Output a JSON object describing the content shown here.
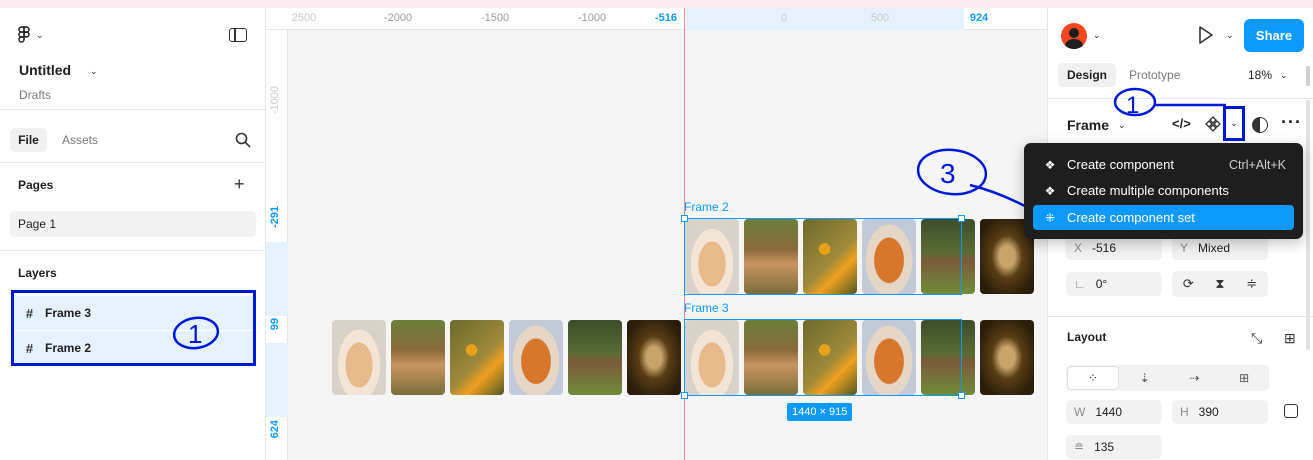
{
  "colors": {
    "accent": "#0d99ff",
    "annotation": "#0019d6",
    "guide": "#f08a8a",
    "avatar": "#f24822"
  },
  "left_panel": {
    "file_title": "Untitled",
    "file_location": "Drafts",
    "tabs": {
      "file": "File",
      "assets": "Assets"
    },
    "pages_heading": "Pages",
    "pages": [
      "Page 1"
    ],
    "layers_heading": "Layers",
    "layers": [
      "Frame 3",
      "Frame 2"
    ],
    "annotation": "1"
  },
  "canvas": {
    "ruler_top": [
      "2500",
      "-2000",
      "-1500",
      "-1000",
      "-516",
      "0",
      "500",
      "924"
    ],
    "ruler_left": [
      "-1000",
      "-291",
      "99",
      "624"
    ],
    "frames": [
      {
        "label": "Frame 2"
      },
      {
        "label": "Frame 3"
      }
    ],
    "size_badge": "1440 × 915",
    "image_subjects": [
      "hamster",
      "deer",
      "hummingbird",
      "fox",
      "elk",
      "wheat"
    ]
  },
  "right_panel": {
    "share_label": "Share",
    "tabs": {
      "design": "Design",
      "prototype": "Prototype"
    },
    "zoom": "18%",
    "selection_type": "Frame",
    "annotation_dropdown": "1",
    "annotation_menu": "3",
    "fields": {
      "x_label": "X",
      "x_value": "-516",
      "y_label": "Y",
      "y_value": "Mixed",
      "rotation": "0°",
      "w_label": "W",
      "w_value": "1440",
      "h_label": "H",
      "h_value": "390",
      "gap_value": "135"
    },
    "layout_heading": "Layout"
  },
  "menu": {
    "items": [
      {
        "label": "Create component",
        "shortcut": "Ctrl+Alt+K"
      },
      {
        "label": "Create multiple components",
        "shortcut": ""
      },
      {
        "label": "Create component set",
        "shortcut": ""
      }
    ]
  }
}
